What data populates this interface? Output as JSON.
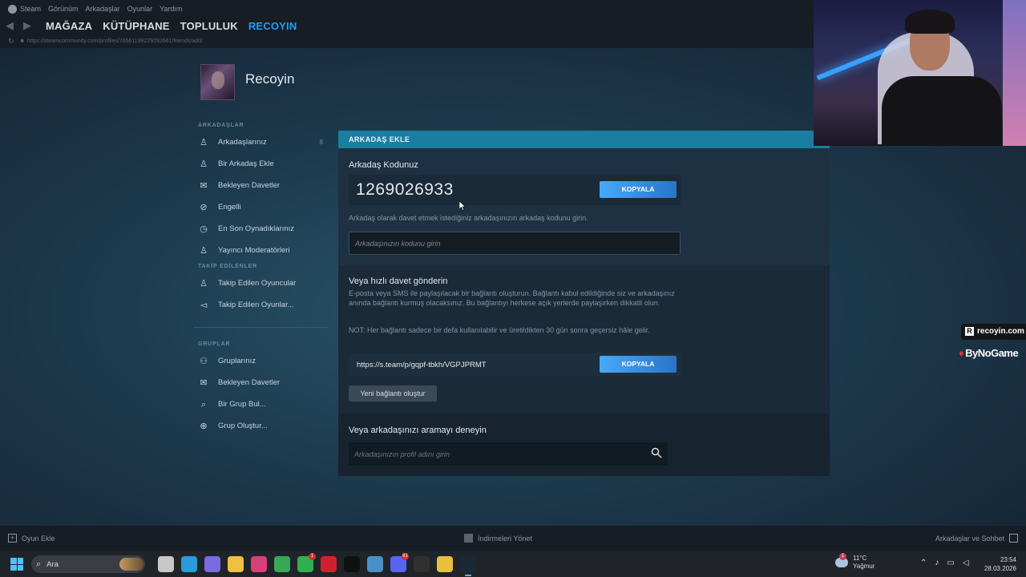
{
  "menubar": {
    "items": [
      "Steam",
      "Görünüm",
      "Arkadaşlar",
      "Oyunlar",
      "Yardım"
    ]
  },
  "nav": {
    "tabs": [
      "MAĞAZA",
      "KÜTÜPHANE",
      "TOPLULUK",
      "RECOYIN"
    ],
    "active": "RECOYIN"
  },
  "url": "https://steamcommunity.com/profiles/76561199229292661/friends/add/",
  "profile": {
    "name": "Recoyin"
  },
  "sidebar": {
    "friends_heading": "ARKADAŞLAR",
    "friends_items": [
      {
        "label": "Arkadaşlarınız",
        "icon": "person-icon",
        "count": "8"
      },
      {
        "label": "Bir Arkadaş Ekle",
        "icon": "person-add-icon"
      },
      {
        "label": "Bekleyen Davetler",
        "icon": "envelope-icon"
      },
      {
        "label": "Engelli",
        "icon": "block-icon"
      },
      {
        "label": "En Son Oynadıklarınız",
        "icon": "clock-icon"
      },
      {
        "label": "Yayıncı Moderatörleri",
        "icon": "person-icon"
      }
    ],
    "following_heading": "TAKİP EDİLENLER",
    "following_items": [
      {
        "label": "Takip Edilen Oyuncular",
        "icon": "person-add-icon"
      },
      {
        "label": "Takip Edilen Oyunlar...",
        "icon": "megaphone-icon"
      }
    ],
    "groups_heading": "GRUPLAR",
    "groups_items": [
      {
        "label": "Gruplarınız",
        "icon": "group-icon"
      },
      {
        "label": "Bekleyen Davetler",
        "icon": "envelope-icon"
      },
      {
        "label": "Bir Grup Bul...",
        "icon": "search-icon"
      },
      {
        "label": "Grup Oluştur...",
        "icon": "plus-circle-icon"
      }
    ]
  },
  "panel": {
    "header": "ARKADAŞ EKLE",
    "code_title": "Arkadaş Kodunuz",
    "friend_code": "1269026933",
    "copy_label": "KOPYALA",
    "code_hint": "Arkadaş olarak davet etmek istediğiniz arkadaşınızın arkadaş kodunu girin.",
    "code_placeholder": "Arkadaşınızın kodunu girin",
    "quick_title": "Veya hızlı davet gönderin",
    "quick_desc": "E-posta veya SMS ile paylaşılacak bir bağlantı oluşturun. Bağlantı kabul edildiğinde siz ve arkadaşınız anında bağlantı kurmuş olacaksınız. Bu bağlantıyı herkese açık yerlerde paylaşırken dikkatli olun.",
    "quick_note": "NOT: Her bağlantı sadece bir defa kullanılabilir ve üretildikten 30 gün sonra geçersiz hâle gelir.",
    "invite_link": "https://s.team/p/gqpf-tbkh/VGPJPRMT",
    "new_link_label": "Yeni bağlantı oluştur",
    "search_title": "Veya arkadaşınızı aramayı deneyin",
    "search_placeholder": "Arkadaşınızın profil adını girin"
  },
  "overlay": {
    "brand_site": "recoyin.com",
    "brand_logo": "ByNoGame"
  },
  "footer": {
    "add_game": "Oyun Ekle",
    "downloads": "İndirmeleri Yönet",
    "friends_chat": "Arkadaşlar ve Sohbet"
  },
  "taskbar": {
    "search_label": "Ara",
    "apps": [
      {
        "name": "task-view-icon",
        "color": "#c8c8c8"
      },
      {
        "name": "edge-icon",
        "color": "#2a9ad8"
      },
      {
        "name": "copilot-icon",
        "color": "#7a6ae0"
      },
      {
        "name": "file-explorer-icon",
        "color": "#f0c040"
      },
      {
        "name": "instagram-icon",
        "color": "#d8407a"
      },
      {
        "name": "chrome-icon",
        "color": "#38a858"
      },
      {
        "name": "whatsapp-icon",
        "color": "#30b050",
        "badge": "1"
      },
      {
        "name": "opera-icon",
        "color": "#d02030"
      },
      {
        "name": "recoyin-icon",
        "color": "#111111"
      },
      {
        "name": "network-icon",
        "color": "#4a90c8"
      },
      {
        "name": "discord-icon",
        "color": "#5865f2",
        "badge": "91"
      },
      {
        "name": "obs-icon",
        "color": "#303030"
      },
      {
        "name": "notes-icon",
        "color": "#e8c040"
      },
      {
        "name": "steam-icon",
        "color": "#1b2838",
        "active": true
      }
    ],
    "weather_temp": "11°C",
    "weather_desc": "Yağmur",
    "weather_badge": "1",
    "time": "23:54",
    "date": "28.03.2026"
  }
}
